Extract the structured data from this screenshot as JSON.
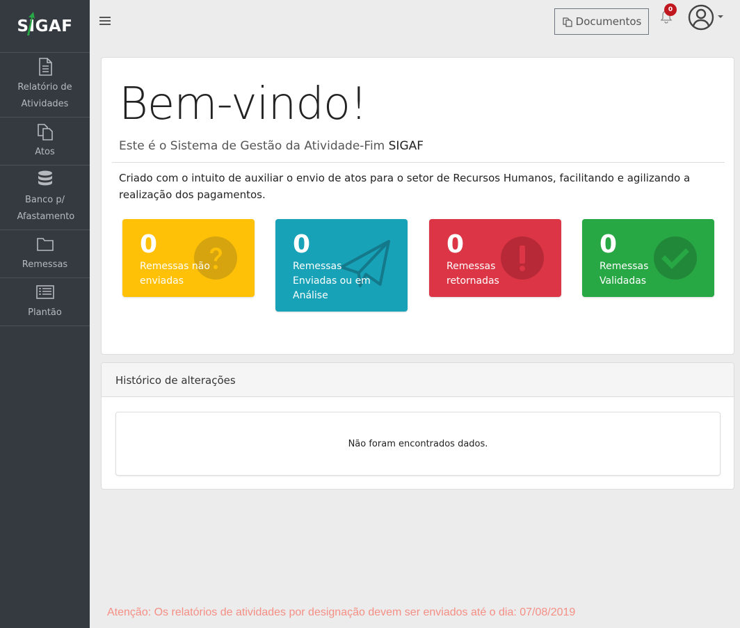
{
  "brand": {
    "name": "SIGAF",
    "accent": "#28a745"
  },
  "sidebar": {
    "items": [
      {
        "label": "Relatório de Atividades",
        "icon": "file-text-icon"
      },
      {
        "label": "Atos",
        "icon": "copy-icon"
      },
      {
        "label": "Banco p/ Afastamento",
        "icon": "database-icon"
      },
      {
        "label": "Remessas",
        "icon": "folder-icon"
      },
      {
        "label": "Plantão",
        "icon": "list-alt-icon"
      }
    ]
  },
  "topbar": {
    "documents_label": "Documentos",
    "notifications_count": "0"
  },
  "welcome": {
    "title": "Bem-vindo!",
    "subtitle_prefix": "Este é o Sistema de Gestão da Atividade-Fim",
    "subtitle_brand": "SIGAF",
    "description": "Criado com o intuito de auxiliar o envio de atos para o setor de Recursos Humanos, facilitando e agilizando a realização dos pagamentos."
  },
  "tiles": [
    {
      "count": "0",
      "label": "Remessas não enviadas",
      "color": "#ffc107",
      "icon": "question-circle-icon"
    },
    {
      "count": "0",
      "label": "Remessas Enviadas ou em Análise",
      "color": "#17a2b8",
      "icon": "paper-plane-icon"
    },
    {
      "count": "0",
      "label": "Remessas retornadas",
      "color": "#dc3545",
      "icon": "exclamation-circle-icon"
    },
    {
      "count": "0",
      "label": "Remessas Validadas",
      "color": "#28a745",
      "icon": "check-circle-icon"
    }
  ],
  "history": {
    "title": "Histórico de alterações",
    "empty_message": "Não foram encontrados dados."
  },
  "notice": "Atenção: Os relatórios de atividades por designação devem ser enviados até o dia: 07/08/2019"
}
